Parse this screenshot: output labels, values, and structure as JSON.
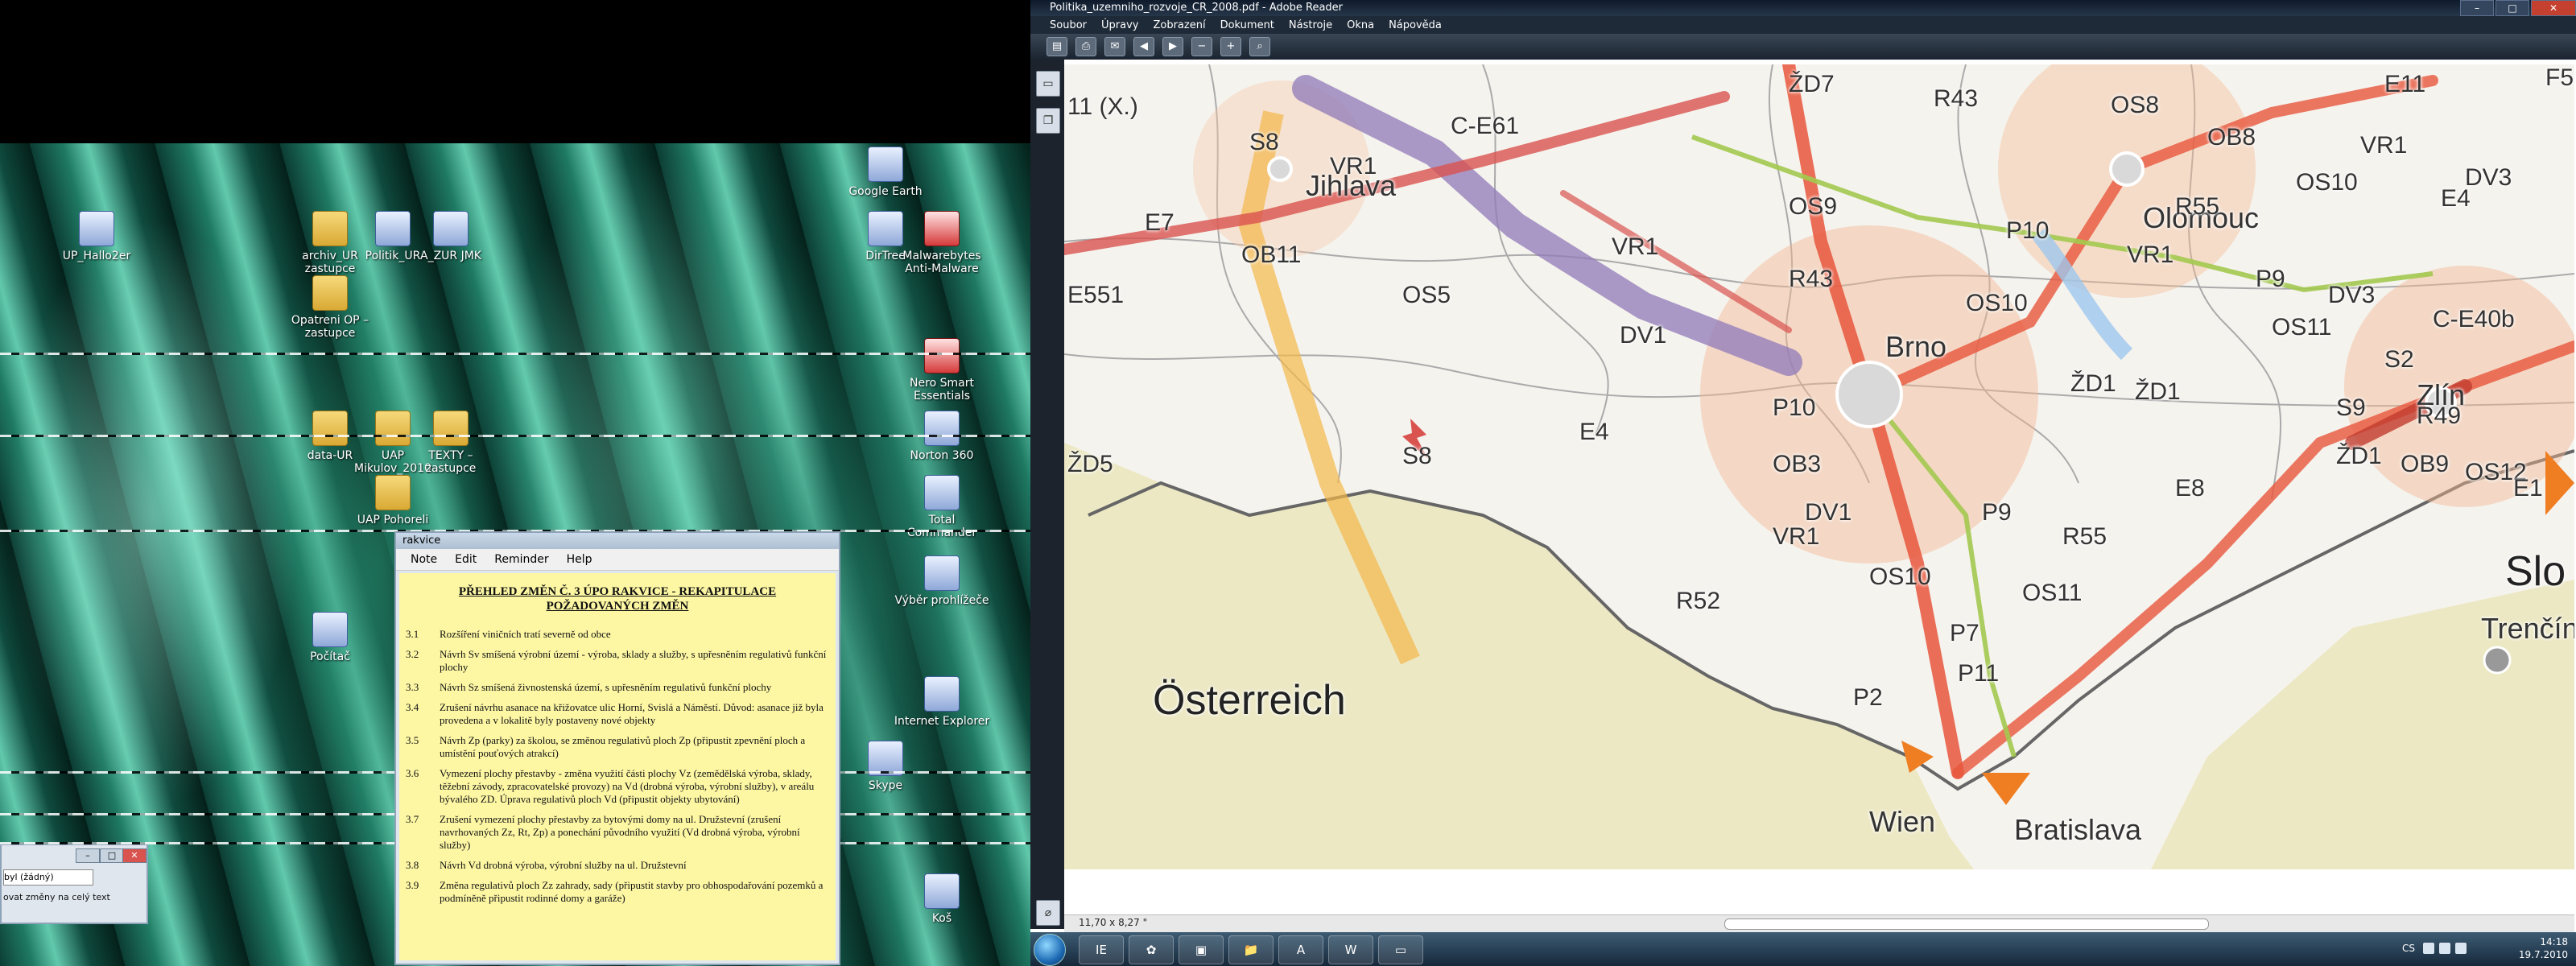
{
  "desktop": {
    "icons": [
      {
        "label": "UP_Hallo2er",
        "kind": "app"
      },
      {
        "label": "archiv_UR zastupce",
        "kind": "folder"
      },
      {
        "label": "Politik_UR",
        "kind": "app"
      },
      {
        "label": "A_ZUR JMK",
        "kind": "app"
      },
      {
        "label": "Opatreni OP – zastupce",
        "kind": "folder"
      },
      {
        "label": "Google Earth",
        "kind": "app"
      },
      {
        "label": "DirTree",
        "kind": "app"
      },
      {
        "label": "Malwarebytes Anti-Malware",
        "kind": "red"
      },
      {
        "label": "Nero Smart Essentials",
        "kind": "red"
      },
      {
        "label": "data-UR",
        "kind": "folder"
      },
      {
        "label": "UAP Mikulov_2010",
        "kind": "folder"
      },
      {
        "label": "TEXTY – zastupce",
        "kind": "folder"
      },
      {
        "label": "Norton 360",
        "kind": "app"
      },
      {
        "label": "UAP Pohoreli",
        "kind": "folder"
      },
      {
        "label": "Total Commander",
        "kind": "app"
      },
      {
        "label": "Výběr prohlížeče",
        "kind": "app"
      },
      {
        "label": "Počítač",
        "kind": "app"
      },
      {
        "label": "Internet Explorer",
        "kind": "app"
      },
      {
        "label": "Skype",
        "kind": "app"
      },
      {
        "label": "Koš",
        "kind": "app"
      }
    ]
  },
  "small_window": {
    "select_value": "byl (žádný)",
    "text": "ovat změny na celý text",
    "controls": [
      "–",
      "□",
      "✕"
    ]
  },
  "notes": {
    "title": "rakvice",
    "menu": [
      "Note",
      "Edit",
      "Reminder",
      "Help"
    ],
    "heading": "PŘEHLED ZMĚN Č. 3 ÚPO RAKVICE - REKAPITULACE POŽADOVANÝCH ZMĚN",
    "items": [
      {
        "num": "3.1",
        "text": "Rozšíření viničních tratí severně od obce"
      },
      {
        "num": "3.2",
        "text": "Návrh Sv smíšená výrobní území - výroba, sklady a služby, s upřesněním regulativů funkční plochy"
      },
      {
        "num": "3.3",
        "text": "Návrh Sz smíšená živnostenská území, s upřesněním regulativů funkční plochy"
      },
      {
        "num": "3.4",
        "text": "Zrušení návrhu asanace na křižovatce ulic Horní, Svislá a Náměstí. Důvod: asanace již byla provedena a v lokalitě byly postaveny nové objekty"
      },
      {
        "num": "3.5",
        "text": "Návrh Zp (parky) za školou, se změnou regulativů ploch Zp (připustit zpevnění ploch a umístění pouťových atrakcí)"
      },
      {
        "num": "3.6",
        "text": "Vymezení plochy přestavby - změna využití části plochy Vz (zemědělská výroba, sklady, těžební závody, zpracovatelské provozy) na Vd (drobná výroba, výrobní služby), v areálu bývalého ZD. Úprava regulativů ploch Vd (připustit objekty ubytování)"
      },
      {
        "num": "3.7",
        "text": "Zrušení vymezení plochy přestavby za bytovými domy na ul. Družstevní (zrušení navrhovaných Zz, Rt, Zp) a ponechání původního využití (Vd drobná výroba, výrobní služby)"
      },
      {
        "num": "3.8",
        "text": "Návrh Vd drobná výroba, výrobní služby na ul. Družstevní"
      },
      {
        "num": "3.9",
        "text": "Změna regulativů ploch Zz zahrady, sady (připustit stavby pro obhospodařování pozemků a podmíněně připustit rodinné domy a garáže)"
      }
    ]
  },
  "reader": {
    "title": "Politika_uzemniho_rozvoje_CR_2008.pdf - Adobe Reader",
    "menu": [
      "Soubor",
      "Úpravy",
      "Zobrazení",
      "Dokument",
      "Nástroje",
      "Okna",
      "Nápověda"
    ],
    "window_buttons": [
      "–",
      "□",
      "✕"
    ],
    "page_size": "11,70 x 8,27 \"",
    "map_labels": {
      "countries": [
        "Österreich",
        "Slo"
      ],
      "cities": [
        "Jihlava",
        "Brno",
        "Olomouc",
        "Zlín",
        "Wien",
        "Bratislava",
        "Trenčín"
      ],
      "corridors": [
        "11 (X.)",
        "ŽD7",
        "R43",
        "OS8",
        "E11",
        "F5",
        "S8",
        "VR1",
        "C-E61",
        "OB8",
        "VR1",
        "DV3",
        "E7",
        "OS9",
        "R55",
        "OS10",
        "E4",
        "OB11",
        "VR1",
        "P10",
        "VR1",
        "P9",
        "DV3",
        "C-E40b",
        "E551",
        "OS5",
        "R43",
        "OS10",
        "OS11",
        "DV1",
        "S2",
        "ŽD1",
        "ŽD1",
        "S9",
        "R49",
        "E4",
        "S8",
        "P10",
        "ŽD5",
        "OB3",
        "ŽD1",
        "OB9",
        "OS12",
        "E8",
        "E1",
        "DV1",
        "P9",
        "R55",
        "VR1",
        "OS10",
        "OS11",
        "R52",
        "P7",
        "P11",
        "P2"
      ]
    }
  },
  "taskbar": {
    "apps": [
      "IE",
      "✿",
      "▣",
      "📁",
      "A",
      "W",
      "▭"
    ],
    "lang": "CS",
    "time": "14:18",
    "date": "19.7.2010"
  }
}
